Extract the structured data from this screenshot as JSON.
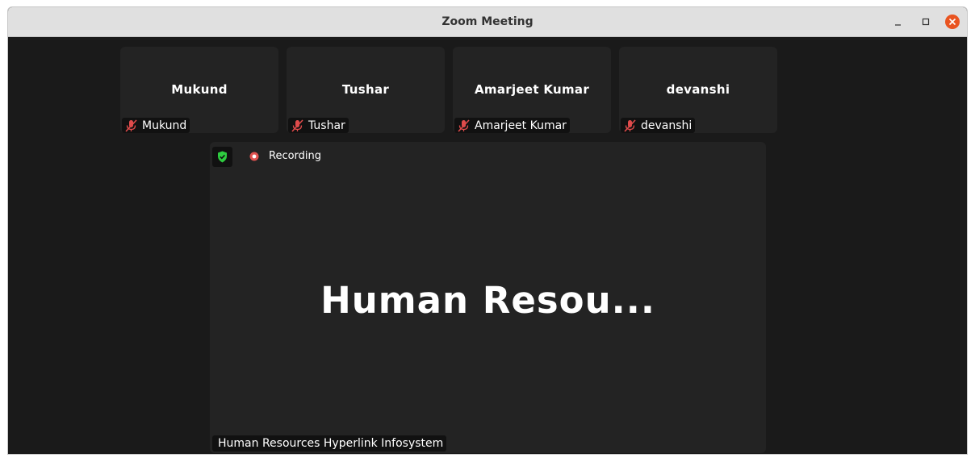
{
  "window": {
    "title": "Zoom Meeting"
  },
  "colors": {
    "close_button": "#e95420",
    "muted_mic": "#e04b4b",
    "security_shield": "#2ecc40",
    "recording": "#e0524f",
    "tile_background": "#232323"
  },
  "participants": [
    {
      "display_name": "Mukund",
      "label": "Mukund",
      "mic_icon": "mic-muted-icon"
    },
    {
      "display_name": "Tushar",
      "label": "Tushar",
      "mic_icon": "mic-muted-icon"
    },
    {
      "display_name": "Amarjeet Kumar",
      "label": "Amarjeet Kumar",
      "mic_icon": "mic-muted-icon"
    },
    {
      "display_name": "devanshi",
      "label": "devanshi",
      "mic_icon": "mic-muted-icon"
    }
  ],
  "main_view": {
    "security_icon": "shield-check-icon",
    "recording_text": "Recording",
    "big_name": "Human Resou...",
    "label": "Human Resources Hyperlink Infosystem"
  }
}
